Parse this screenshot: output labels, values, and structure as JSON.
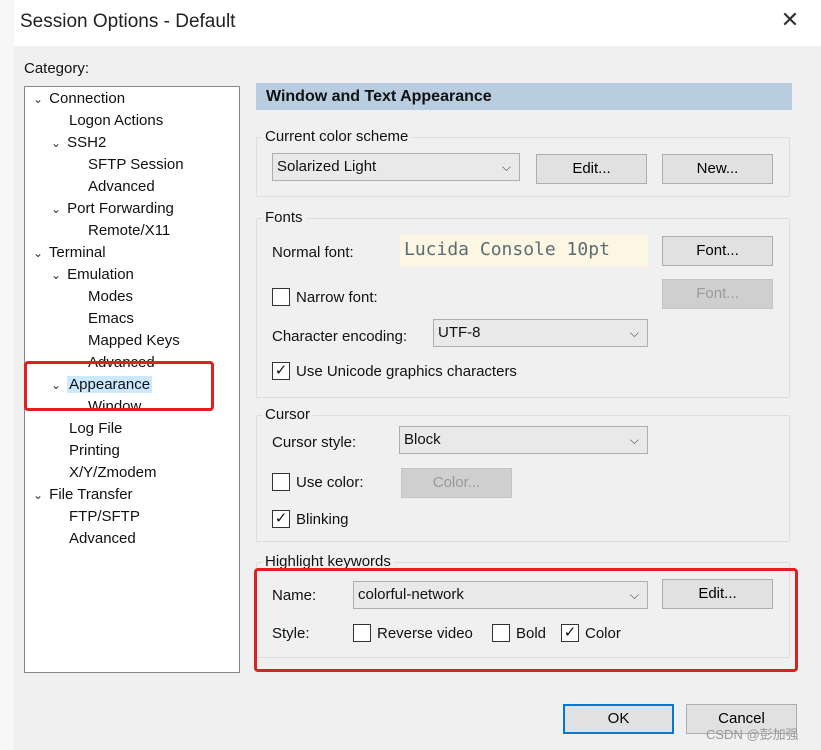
{
  "window": {
    "title": "Session Options - Default"
  },
  "category": {
    "label": "Category:",
    "items": [
      {
        "label": "Connection",
        "chev": "v"
      },
      {
        "label": "Logon Actions",
        "chev": ""
      },
      {
        "label": "SSH2",
        "chev": "v"
      },
      {
        "label": "SFTP Session",
        "chev": ""
      },
      {
        "label": "Advanced",
        "chev": ""
      },
      {
        "label": "Port Forwarding",
        "chev": "v"
      },
      {
        "label": "Remote/X11",
        "chev": ""
      },
      {
        "label": "Terminal",
        "chev": "v"
      },
      {
        "label": "Emulation",
        "chev": "v"
      },
      {
        "label": "Modes",
        "chev": ""
      },
      {
        "label": "Emacs",
        "chev": ""
      },
      {
        "label": "Mapped Keys",
        "chev": ""
      },
      {
        "label": "Advanced",
        "chev": ""
      },
      {
        "label": "Appearance",
        "chev": "v"
      },
      {
        "label": "Window",
        "chev": ""
      },
      {
        "label": "Log File",
        "chev": ""
      },
      {
        "label": "Printing",
        "chev": ""
      },
      {
        "label": "X/Y/Zmodem",
        "chev": ""
      },
      {
        "label": "File Transfer",
        "chev": "v"
      },
      {
        "label": "FTP/SFTP",
        "chev": ""
      },
      {
        "label": "Advanced",
        "chev": ""
      }
    ]
  },
  "panel": {
    "header": "Window and Text Appearance",
    "color_scheme": {
      "group": "Current color scheme",
      "value": "Solarized Light",
      "edit": "Edit...",
      "new": "New..."
    },
    "fonts": {
      "group": "Fonts",
      "normal_label": "Normal font:",
      "normal_value": "Lucida Console 10pt",
      "font_btn": "Font...",
      "narrow_label": "Narrow font:",
      "narrow_btn": "Font...",
      "encoding_label": "Character encoding:",
      "encoding_value": "UTF-8",
      "unicode_label": "Use Unicode graphics characters"
    },
    "cursor": {
      "group": "Cursor",
      "style_label": "Cursor style:",
      "style_value": "Block",
      "use_color_label": "Use color:",
      "color_btn": "Color...",
      "blinking_label": "Blinking"
    },
    "highlight": {
      "group": "Highlight keywords",
      "name_label": "Name:",
      "name_value": "colorful-network",
      "edit": "Edit...",
      "style_label": "Style:",
      "reverse": "Reverse video",
      "bold": "Bold",
      "color": "Color"
    }
  },
  "buttons": {
    "ok": "OK",
    "cancel": "Cancel"
  },
  "watermark": "CSDN @彭加强",
  "check": "✓",
  "close_glyph": "✕",
  "arrow_glyph": "⌵"
}
